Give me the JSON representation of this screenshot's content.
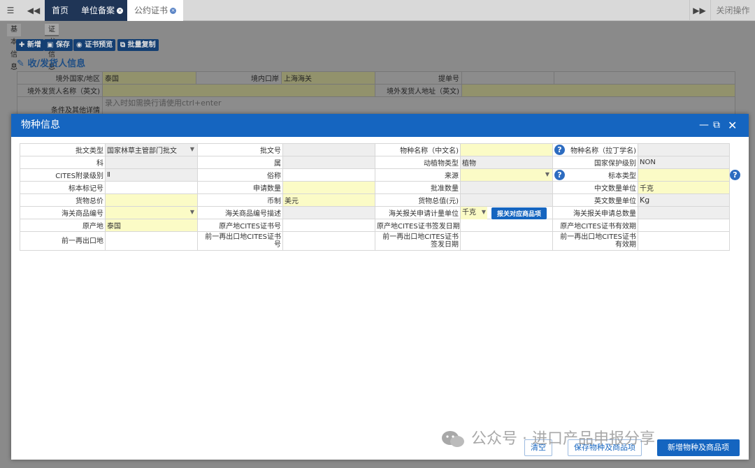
{
  "topbar": {
    "home_tab": "首页",
    "tab_unit": "单位备案",
    "tab_cites": "公约证书",
    "close_ops": "关闭操作"
  },
  "subtabs": {
    "basic": "基本信息",
    "cert": "证书信息"
  },
  "toolbar": {
    "add": "新增",
    "save": "保存",
    "preview": "证书预览",
    "batch_copy": "批量复制"
  },
  "section_title": "收/发货人信息",
  "bg_form": {
    "country_label": "境外国家/地区",
    "country_value": "泰国",
    "port_label": "境内口岸",
    "port_value": "上海海关",
    "bill_label": "提单号",
    "sender_name_label": "境外发货人名称（英文)",
    "sender_addr_label": "境外发货人地址（英文)",
    "conditions_label": "条件及其他详情",
    "conditions_placeholder": "录入时如需换行请使用ctrl+enter"
  },
  "modal": {
    "title": "物种信息",
    "rows": {
      "r1": {
        "l1": "批文类型",
        "v1": "国家林草主管部门批文",
        "l2": "批文号",
        "l3": "物种名称（中文名)",
        "l4": "物种名称（拉丁学名)"
      },
      "r2": {
        "l1": "科",
        "l2": "属",
        "l3": "动植物类型",
        "v3": "植物",
        "l4": "国家保护级别",
        "v4": "NON"
      },
      "r3": {
        "l1": "CITES附录级别",
        "v1": "Ⅱ",
        "l2": "俗称",
        "l3": "来源",
        "l4": "标本类型"
      },
      "r4": {
        "l1": "标本标记号",
        "l2": "申请数量",
        "l3": "批准数量",
        "l4": "中文数量单位",
        "v4": "千克"
      },
      "r5": {
        "l1": "货物总价",
        "l2": "币制",
        "v2": "美元",
        "l3": "货物总值(元)",
        "l4": "英文数量单位",
        "v4": "Kg"
      },
      "r6": {
        "l1": "海关商品编号",
        "l2": "海关商品编号描述",
        "l3": "海关报关申请计量单位",
        "v3": "千克",
        "btn": "报关对应商品项",
        "l4": "海关报关申请总数量"
      },
      "r7": {
        "l1": "原产地",
        "v1": "泰国",
        "l2": "原产地CITES证书号",
        "l3": "原产地CITES证书签发日期",
        "l4": "原产地CITES证书有效期"
      },
      "r8": {
        "l1": "前一再出口地",
        "l2": "前一再出口地CITES证书号",
        "l3": "前一再出口地CITES证书签发日期",
        "l4": "前一再出口地CITES证书有效期"
      }
    },
    "footer": {
      "clear": "清空",
      "save_species": "保存物种及商品项",
      "add_species": "新增物种及商品项"
    }
  },
  "watermark": "公众号 · 进口产品申报分享",
  "colors": {
    "modal_header": "#1565c0",
    "required_field": "#fbfbc6",
    "readonly_field": "#eeeeee",
    "tab_dark": "#1f3556"
  }
}
